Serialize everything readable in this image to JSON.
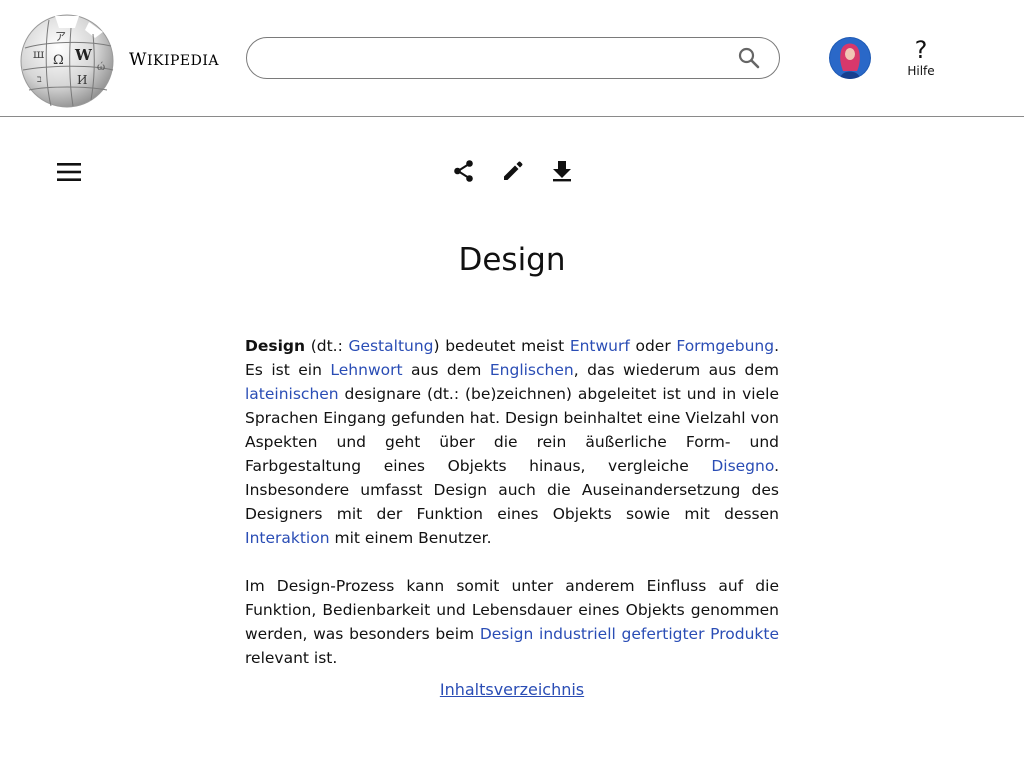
{
  "header": {
    "wordmark_first": "W",
    "wordmark_rest": "IKIPEDIA",
    "search": {
      "value": "",
      "placeholder": ""
    },
    "help_icon": "?",
    "help_label": "Hilfe",
    "icons": {
      "logo": "wikipedia-puzzle-globe",
      "search": "magnifier",
      "avatar": "user-avatar"
    }
  },
  "toolbar": {
    "icons": [
      "hamburger-menu",
      "share",
      "pencil-edit",
      "download-arrow"
    ]
  },
  "article": {
    "title": "Design",
    "p1": {
      "s1": "Design",
      "s2": " (dt.: ",
      "l1": "Gestaltung",
      "s3": ") bedeutet meist ",
      "l2": "Entwurf",
      "s4": " oder ",
      "l3": "Formgebung",
      "s5": ". Es ist ein ",
      "l4": "Lehnwort",
      "s6": " aus dem ",
      "l5": "Englischen",
      "s7": ", das wiederum aus dem ",
      "l6": "lateinischen",
      "s8": " designare (dt.: (be)zeichnen) abgeleitet ist und in viele Sprachen Eingang gefunden hat. Design beinhaltet eine Vielzahl von Aspekten und geht über die rein äußerliche Form- und Farbgestaltung eines Objekts hinaus, vergleiche ",
      "l7": "Disegno",
      "s9": ". Insbesondere umfasst Design auch die Auseinandersetzung des Designers mit der Funktion eines Objekts sowie mit dessen ",
      "l8": "Interaktion",
      "s10": " mit einem Benutzer."
    },
    "p2": {
      "s1": "Im Design-Prozess kann somit unter anderem Einfluss auf die Funktion, Bedienbarkeit und Lebensdauer eines Objekts genommen werden, was besonders beim ",
      "l1": "Design industriell gefertigter Produkte",
      "s2": " relevant ist."
    },
    "toc_link": "Inhaltsverzeichnis"
  },
  "colors": {
    "link": "#2a4db5",
    "text": "#111111",
    "divider": "#8a8a8a",
    "avatar_bg": "#1e5ab4",
    "avatar_accent": "#d8386b"
  }
}
